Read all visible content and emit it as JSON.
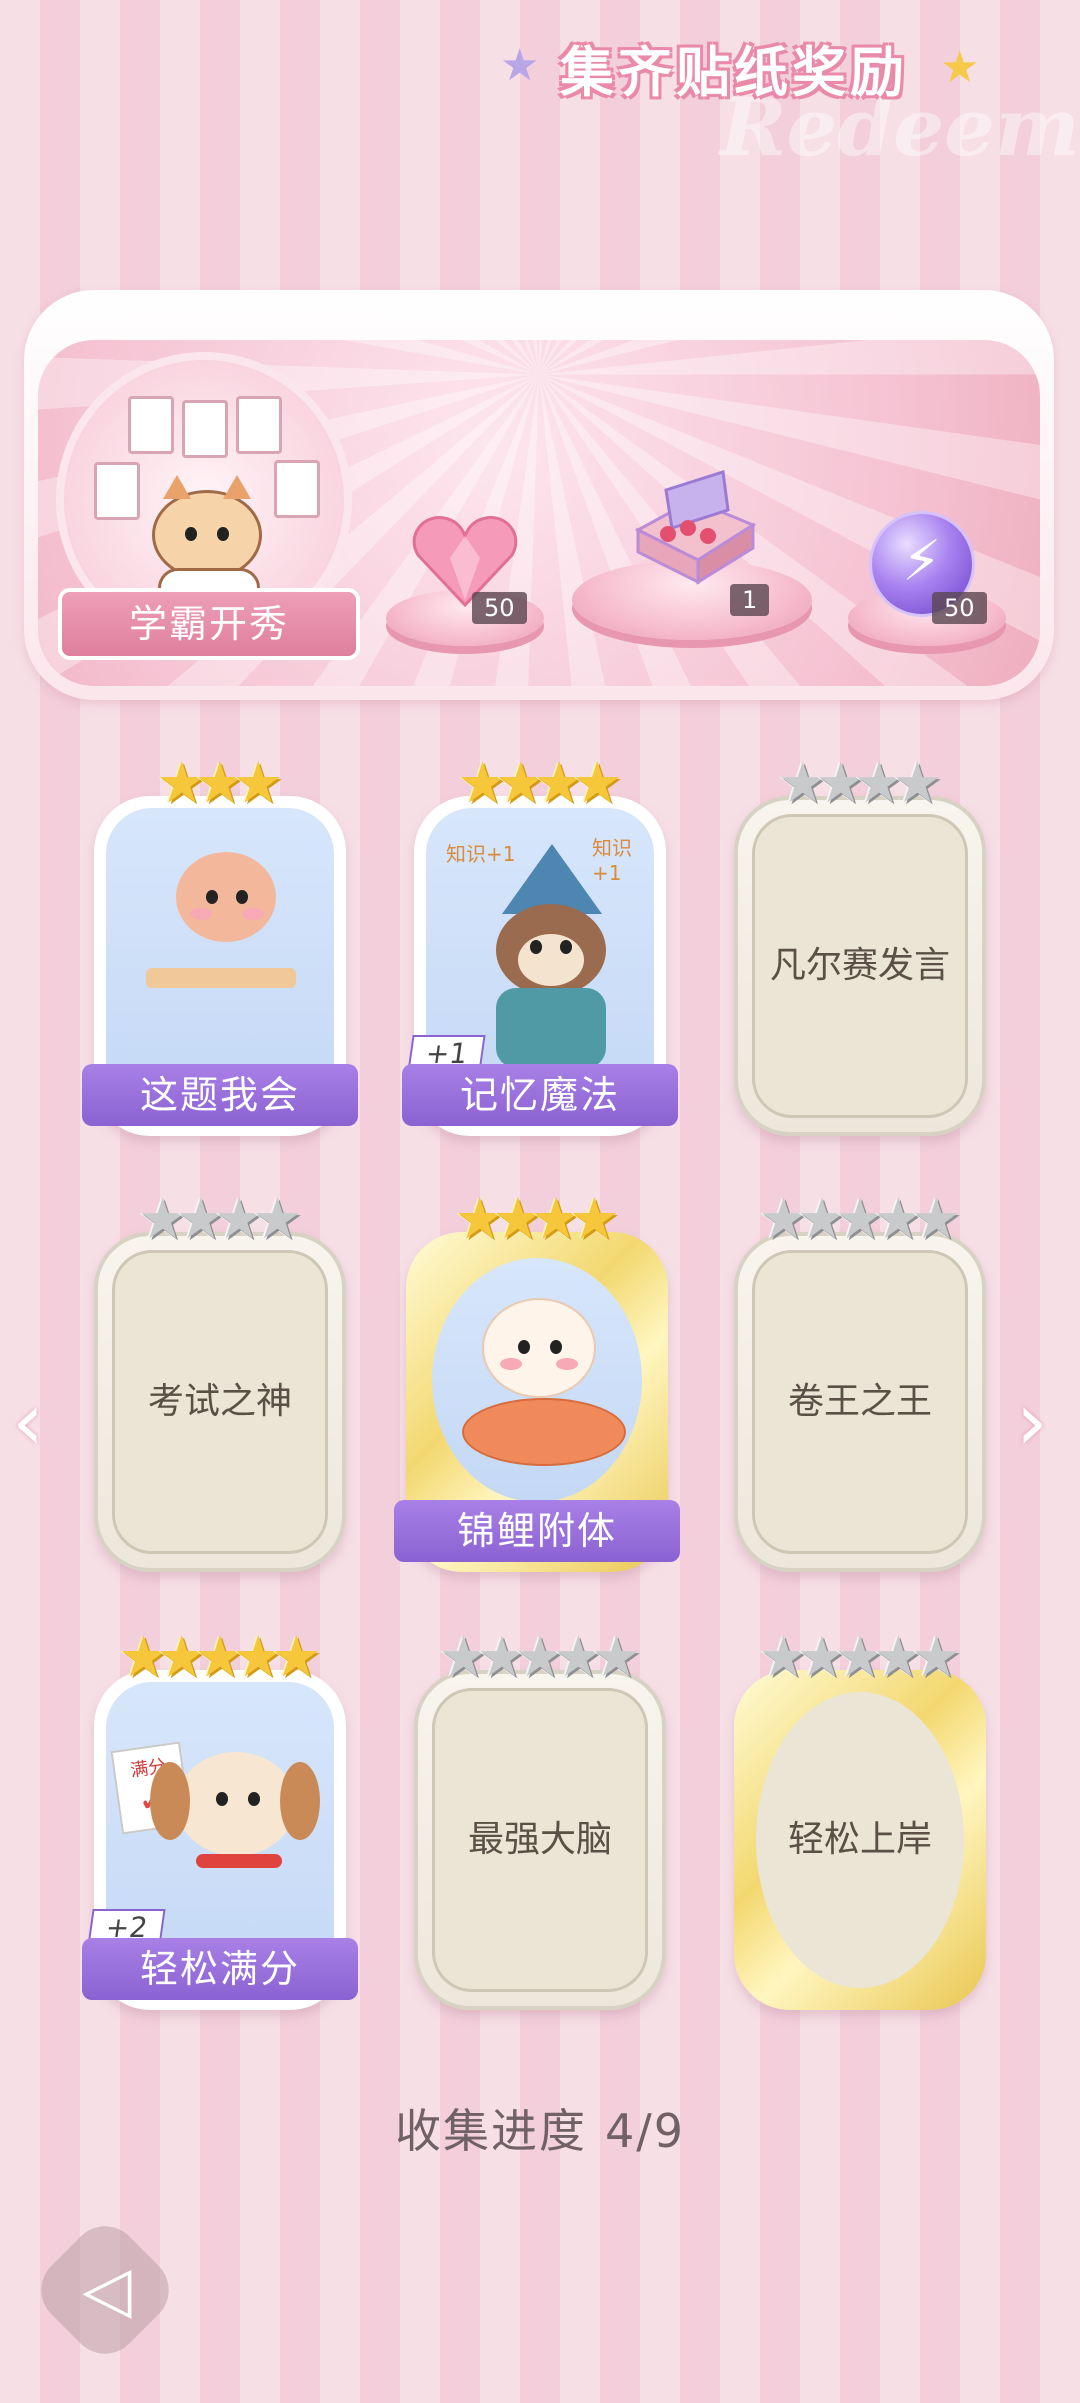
{
  "banner": {
    "title": "集齐贴纸奖励",
    "watermark": "Redeem",
    "badge_label": "学霸开秀",
    "rewards": [
      {
        "icon": "pink-heart-gem-icon",
        "count": "50"
      },
      {
        "icon": "gift-box-icon",
        "count": "1"
      },
      {
        "icon": "purple-energy-orb-icon",
        "count": "50"
      }
    ]
  },
  "cards": [
    {
      "label": "这题我会",
      "collected": true,
      "stars_earned": 3,
      "stars_total": 3,
      "extra": ""
    },
    {
      "label": "记忆魔法",
      "collected": true,
      "stars_earned": 4,
      "stars_total": 4,
      "extra": "+1"
    },
    {
      "label": "凡尔赛发言",
      "collected": false,
      "stars_earned": 0,
      "stars_total": 4,
      "extra": ""
    },
    {
      "label": "考试之神",
      "collected": false,
      "stars_earned": 0,
      "stars_total": 4,
      "extra": ""
    },
    {
      "label": "锦鲤附体",
      "collected": true,
      "stars_earned": 4,
      "stars_total": 4,
      "extra": ""
    },
    {
      "label": "卷王之王",
      "collected": false,
      "stars_earned": 0,
      "stars_total": 5,
      "extra": ""
    },
    {
      "label": "轻松满分",
      "collected": true,
      "stars_earned": 5,
      "stars_total": 5,
      "extra": "+2"
    },
    {
      "label": "最强大脑",
      "collected": false,
      "stars_earned": 0,
      "stars_total": 5,
      "extra": ""
    },
    {
      "label": "轻松上岸",
      "collected": false,
      "stars_earned": 0,
      "stars_total": 5,
      "extra": ""
    }
  ],
  "card_texts": {
    "fullmark_paper": "满分",
    "wizard_note_left": "知识+1",
    "wizard_note_right": "知识+1"
  },
  "progress": {
    "label": "收集进度",
    "value": "4/9"
  },
  "colors": {
    "accent_purple": "#8b62d2",
    "banner_pink": "#f5c2d2",
    "gold_star": "#f7c73b",
    "silver_star": "#c9cacb"
  }
}
